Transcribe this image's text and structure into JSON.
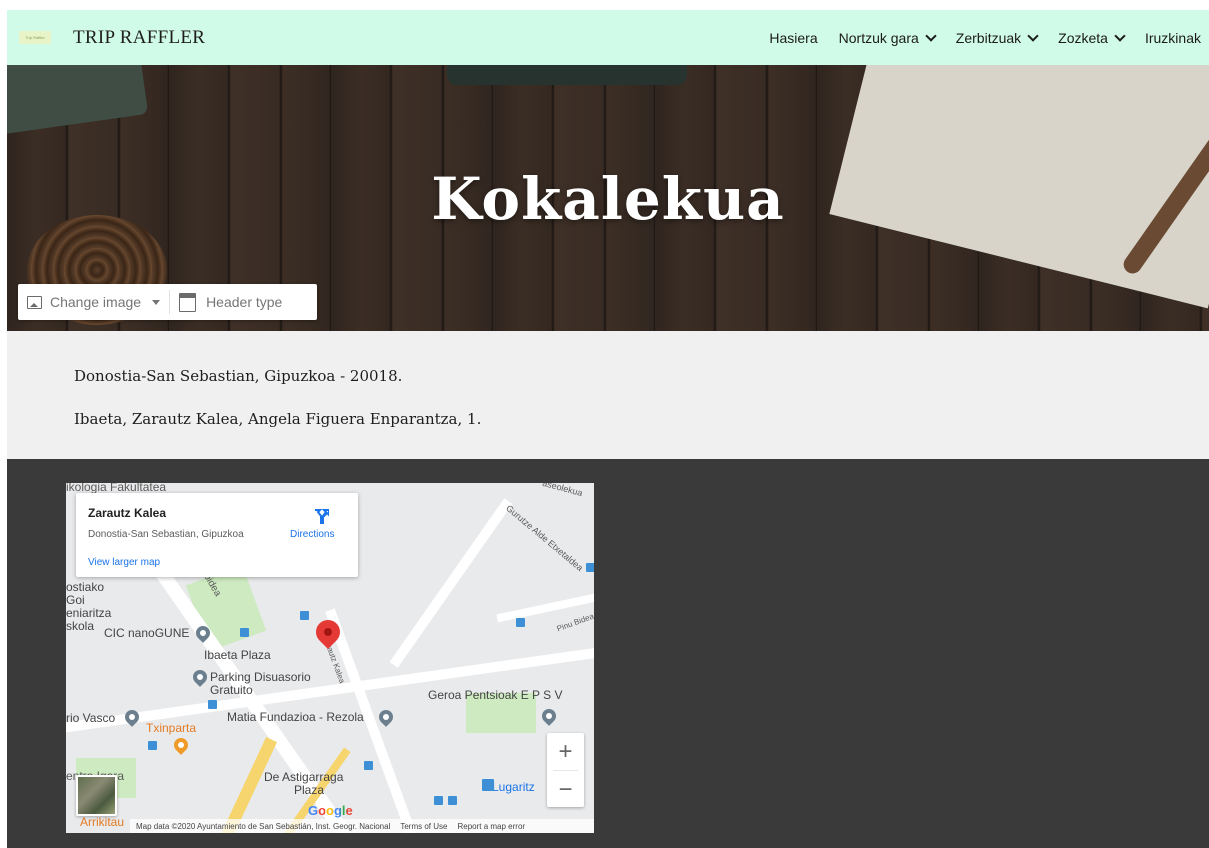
{
  "nav": {
    "logo_alt": "Trip Raffler",
    "brand": "TRIP RAFFLER",
    "items": [
      {
        "label": "Hasiera",
        "dropdown": false
      },
      {
        "label": "Nortzuk gara",
        "dropdown": true
      },
      {
        "label": "Zerbitzuak",
        "dropdown": true
      },
      {
        "label": "Zozketa",
        "dropdown": true
      },
      {
        "label": "Iruzkinak",
        "dropdown": false
      }
    ]
  },
  "hero": {
    "title": "Kokalekua",
    "editor": {
      "change_image": "Change image",
      "header_type": "Header type"
    }
  },
  "address": {
    "line1": "Donostia-San Sebastian, Gipuzkoa - 20018.",
    "line2": "Ibaeta, Zarautz Kalea, Angela Figuera Enparantza, 1."
  },
  "map": {
    "place_title": "Zarautz Kalea",
    "place_subtitle": "Donostia-San Sebastian, Gipuzkoa",
    "directions": "Directions",
    "view_larger": "View larger map",
    "labels": {
      "psikologia": "ikologia Fakultatea",
      "goi": "Goi",
      "ostiako": "ostiako",
      "eniaritza": "eniaritza",
      "skola": "skola",
      "nanogune": "CIC nanoGUNE",
      "ibaeta": "Ibaeta Plaza",
      "parking": "Parking Disuasorio",
      "gratuito": "Gratuito",
      "matia": "Matia Fundazioa - Rezola",
      "geroa": "Geroa Pentsioak E P S V",
      "vasco": "rio Vasco",
      "txinparta": "Txinparta",
      "astigarraga": "De Astigarraga",
      "plaza": "Plaza",
      "lugaritz": "Lugaritz",
      "entro": "entro Igara",
      "arrikitau": "Arrikitau",
      "pinu": "Pinu Bidea",
      "gurutze": "Gurutze Alde Etxetaldea",
      "zarautz_street": "Zarautz Kalea",
      "firibidea": "firibidea",
      "aseolekua": "aseolekua"
    },
    "zoom_in": "+",
    "zoom_out": "−",
    "google": "Google",
    "footer": {
      "data": "Map data ©2020 Ayuntamiento de San Sebastián, Inst. Geogr. Nacional",
      "terms": "Terms of Use",
      "report": "Report a map error"
    },
    "colors": {
      "pin": "#e53935",
      "link": "#1a73e8",
      "poi": "#6b7f8e"
    }
  }
}
